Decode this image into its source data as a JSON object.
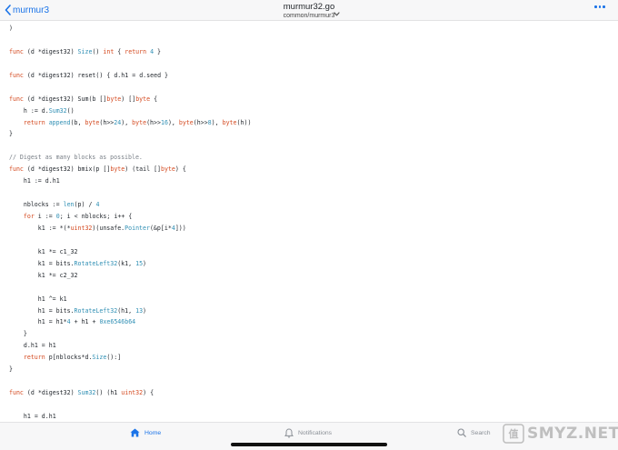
{
  "header": {
    "back_label": "murmur3",
    "title": "murmur32.go",
    "subtitle": "common/murmur3"
  },
  "code": {
    "lines": [
      ")",
      "",
      "func (d *digest32) Size() int { return 4 }",
      "",
      "func (d *digest32) reset() { d.h1 = d.seed }",
      "",
      "func (d *digest32) Sum(b []byte) []byte {",
      "    h := d.Sum32()",
      "    return append(b, byte(h>>24), byte(h>>16), byte(h>>8), byte(h))",
      "}",
      "",
      "// Digest as many blocks as possible.",
      "func (d *digest32) bmix(p []byte) (tail []byte) {",
      "    h1 := d.h1",
      "",
      "    nblocks := len(p) / 4",
      "    for i := 0; i < nblocks; i++ {",
      "        k1 := *(*uint32)(unsafe.Pointer(&p[i*4]))",
      "",
      "        k1 *= c1_32",
      "        k1 = bits.RotateLeft32(k1, 15)",
      "        k1 *= c2_32",
      "",
      "        h1 ^= k1",
      "        h1 = bits.RotateLeft32(h1, 13)",
      "        h1 = h1*4 + h1 + 0xe6546b64",
      "    }",
      "    d.h1 = h1",
      "    return p[nblocks*d.Size():]",
      "}",
      "",
      "func (d *digest32) Sum32() (h1 uint32) {",
      "",
      "    h1 = d.h1"
    ]
  },
  "tabbar": {
    "home_label": "Home",
    "notifications_label": "Notifications",
    "search_label": "Search"
  },
  "watermark": {
    "text": "SMYZ.NET"
  },
  "colors": {
    "accent": "#1a73e8",
    "keyword": "#d4491f",
    "function": "#2f8fb4",
    "comment": "#7a8088"
  },
  "icons": {
    "back": "chevron-left-icon",
    "title_menu": "chevron-down-icon",
    "more": "ellipsis-icon",
    "home": "home-icon",
    "notifications": "bell-icon",
    "search": "search-icon"
  }
}
